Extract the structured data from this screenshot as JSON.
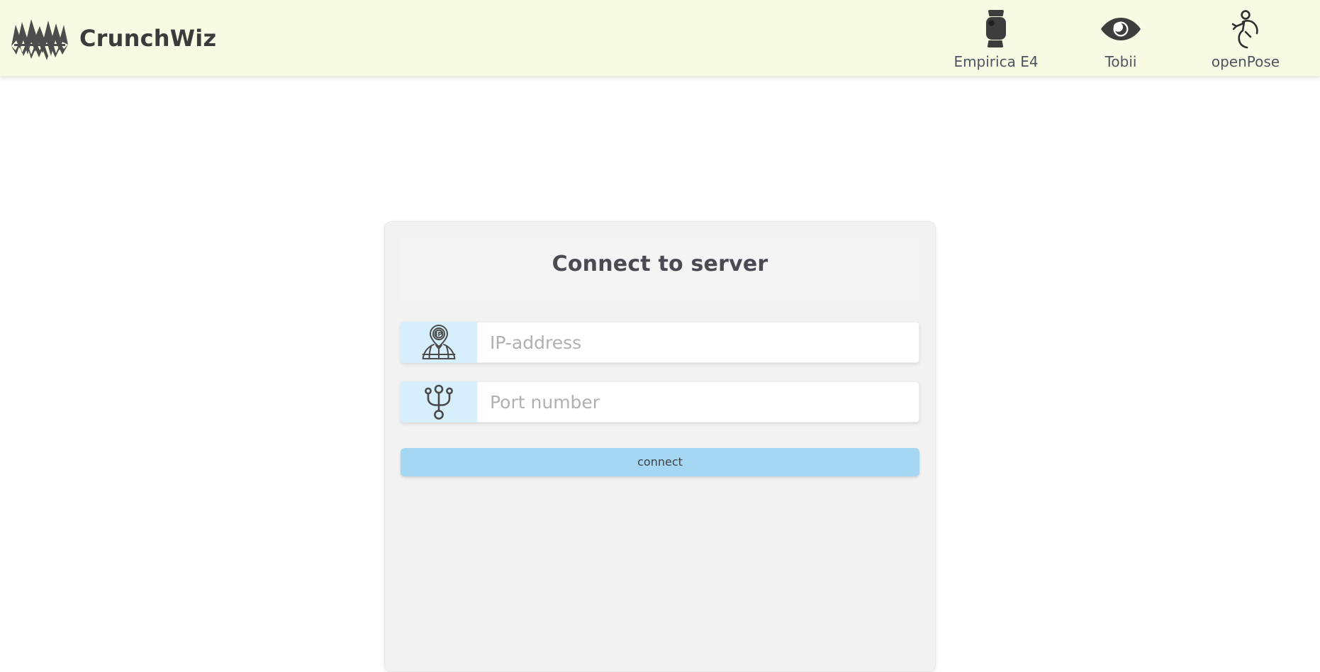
{
  "app": {
    "brand_name": "CrunchWiz",
    "logo_icon": "mountain-waveform-logo",
    "header_bg": "#f7fbe3",
    "page_bg": "#ffffff"
  },
  "nav": {
    "devices": [
      {
        "label": "Empirica E4",
        "icon": "smartwatch-icon"
      },
      {
        "label": "Tobii",
        "icon": "eye-icon"
      },
      {
        "label": "openPose",
        "icon": "running-person-icon"
      }
    ]
  },
  "connect_card": {
    "title": "Connect to server",
    "fields": [
      {
        "name": "ip-address",
        "placeholder": "IP-address",
        "value": "",
        "icon": "ip-location-pin-icon",
        "icon_bg": "#d7eefc"
      },
      {
        "name": "port-number",
        "placeholder": "Port number",
        "value": "",
        "icon": "usb-port-icon",
        "icon_bg": "#d7eefc"
      }
    ],
    "submit_label": "connect",
    "submit_color": "#a5d6f2"
  }
}
